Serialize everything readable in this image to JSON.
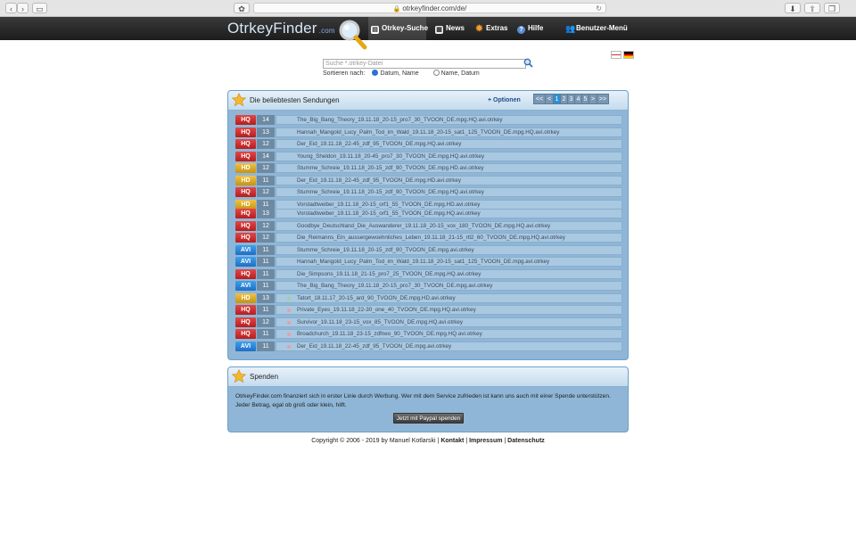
{
  "browser": {
    "url": "otrkeyfinder.com/de/"
  },
  "nav": {
    "logo": "OtrkeyFinder",
    "logo_suffix": ".com",
    "items": [
      {
        "label": "Otrkey-Suche"
      },
      {
        "label": "News"
      },
      {
        "label": "Extras"
      },
      {
        "label": "Hilfe"
      },
      {
        "label": "Benutzer-Menü"
      }
    ]
  },
  "search": {
    "placeholder": "Suche *.otrkey-Datei",
    "sort_label": "Sortieren nach:",
    "sort_options": [
      "Datum, Name",
      "Name, Datum"
    ],
    "sort_selected": "Datum, Name"
  },
  "popular": {
    "title": "Die beliebtesten Sendungen",
    "options_label": "+ Optionen",
    "pager": [
      "<<",
      "<",
      "1",
      "2",
      "3",
      "4",
      "5",
      ">",
      ">>"
    ],
    "current_page": "1",
    "rows": [
      {
        "quality": "HQ",
        "count": "14",
        "file": "The_Big_Bang_Theory_19.11.18_20-15_pro7_30_TVOON_DE.mpg.HQ.avi.otrkey"
      },
      {
        "quality": "HQ",
        "count": "13",
        "file": "Hannah_Mangold_Lucy_Palm_Tod_im_Wald_19.11.18_20-15_sat1_125_TVOON_DE.mpg.HQ.avi.otrkey"
      },
      {
        "quality": "HQ",
        "count": "12",
        "file": "Der_Eid_19.11.18_22-45_zdf_95_TVOON_DE.mpg.HQ.avi.otrkey"
      },
      {
        "quality": "HQ",
        "count": "14",
        "file": "Young_Sheldon_19.11.18_20-45_pro7_30_TVOON_DE.mpg.HQ.avi.otrkey"
      },
      {
        "quality": "HD",
        "count": "12",
        "file": "Stumme_Schreie_19.11.18_20-15_zdf_90_TVOON_DE.mpg.HD.avi.otrkey"
      },
      {
        "quality": "HD",
        "count": "11",
        "file": "Der_Eid_19.11.18_22-45_zdf_95_TVOON_DE.mpg.HD.avi.otrkey"
      },
      {
        "quality": "HQ",
        "count": "12",
        "file": "Stumme_Schreie_19.11.18_20-15_zdf_90_TVOON_DE.mpg.HQ.avi.otrkey"
      },
      {
        "quality": "HD",
        "count": "11",
        "file": "Vorstadtweiber_19.11.18_20-15_orf1_55_TVOON_DE.mpg.HD.avi.otrkey"
      },
      {
        "quality": "HQ",
        "count": "13",
        "file": "Vorstadtweiber_19.11.18_20-15_orf1_55_TVOON_DE.mpg.HQ.avi.otrkey"
      },
      {
        "quality": "HQ",
        "count": "12",
        "file": "Goodbye_Deutschland_Die_Auswanderer_19.11.18_20-15_vox_180_TVOON_DE.mpg.HQ.avi.otrkey"
      },
      {
        "quality": "HQ",
        "count": "12",
        "file": "Die_Reimanns_Ein_aussergewoehnliches_Leben_19.11.18_21-15_rtl2_60_TVOON_DE.mpg.HQ.avi.otrkey"
      },
      {
        "quality": "AVI",
        "count": "11",
        "file": "Stumme_Schreie_19.11.18_20-15_zdf_90_TVOON_DE.mpg.avi.otrkey"
      },
      {
        "quality": "AVI",
        "count": "11",
        "file": "Hannah_Mangold_Lucy_Palm_Tod_im_Wald_19.11.18_20-15_sat1_125_TVOON_DE.mpg.avi.otrkey"
      },
      {
        "quality": "HQ",
        "count": "11",
        "file": "Die_Simpsons_19.11.18_21-15_pro7_25_TVOON_DE.mpg.HQ.avi.otrkey"
      },
      {
        "quality": "AVI",
        "count": "11",
        "file": "The_Big_Bang_Theory_19.11.18_20-15_pro7_30_TVOON_DE.mpg.avi.otrkey"
      },
      {
        "quality": "HD",
        "count": "13",
        "file": "Tatort_18.11.17_20-15_ard_90_TVOON_DE.mpg.HD.avi.otrkey"
      },
      {
        "quality": "HQ",
        "count": "11",
        "file": "Private_Eyes_19.11.18_22-30_one_40_TVOON_DE.mpg.HQ.avi.otrkey"
      },
      {
        "quality": "HQ",
        "count": "12",
        "file": "Survivor_19.11.18_23-15_vox_85_TVOON_DE.mpg.HQ.avi.otrkey"
      },
      {
        "quality": "HQ",
        "count": "11",
        "file": "Broadchurch_19.11.18_23-15_zdfneo_90_TVOON_DE.mpg.HQ.avi.otrkey"
      },
      {
        "quality": "AVI",
        "count": "11",
        "file": "Der_Eid_19.11.18_22-45_zdf_95_TVOON_DE.mpg.avi.otrkey"
      }
    ]
  },
  "donate": {
    "title": "Spenden",
    "text": "OtrkeyFinder.com finanziert sich in erster Linie durch Werbung. Wer mit dem Service zufrieden ist kann uns auch mit einer Spende unterstützen. Jeder Betrag, egal ob groß oder klein, hilft.",
    "button": "Jetzt mit Paypal spenden"
  },
  "footer": {
    "copyright": "Copyright © 2006 - 2019 by Manuel Kotlarski",
    "links": [
      "Kontakt",
      "Impressum",
      "Datenschutz"
    ]
  },
  "colors": {
    "hq": "#c62b2b",
    "hd": "#e0ad25",
    "avi": "#2b86d8",
    "panel": "#8fb6d6",
    "nav": "#262626"
  }
}
